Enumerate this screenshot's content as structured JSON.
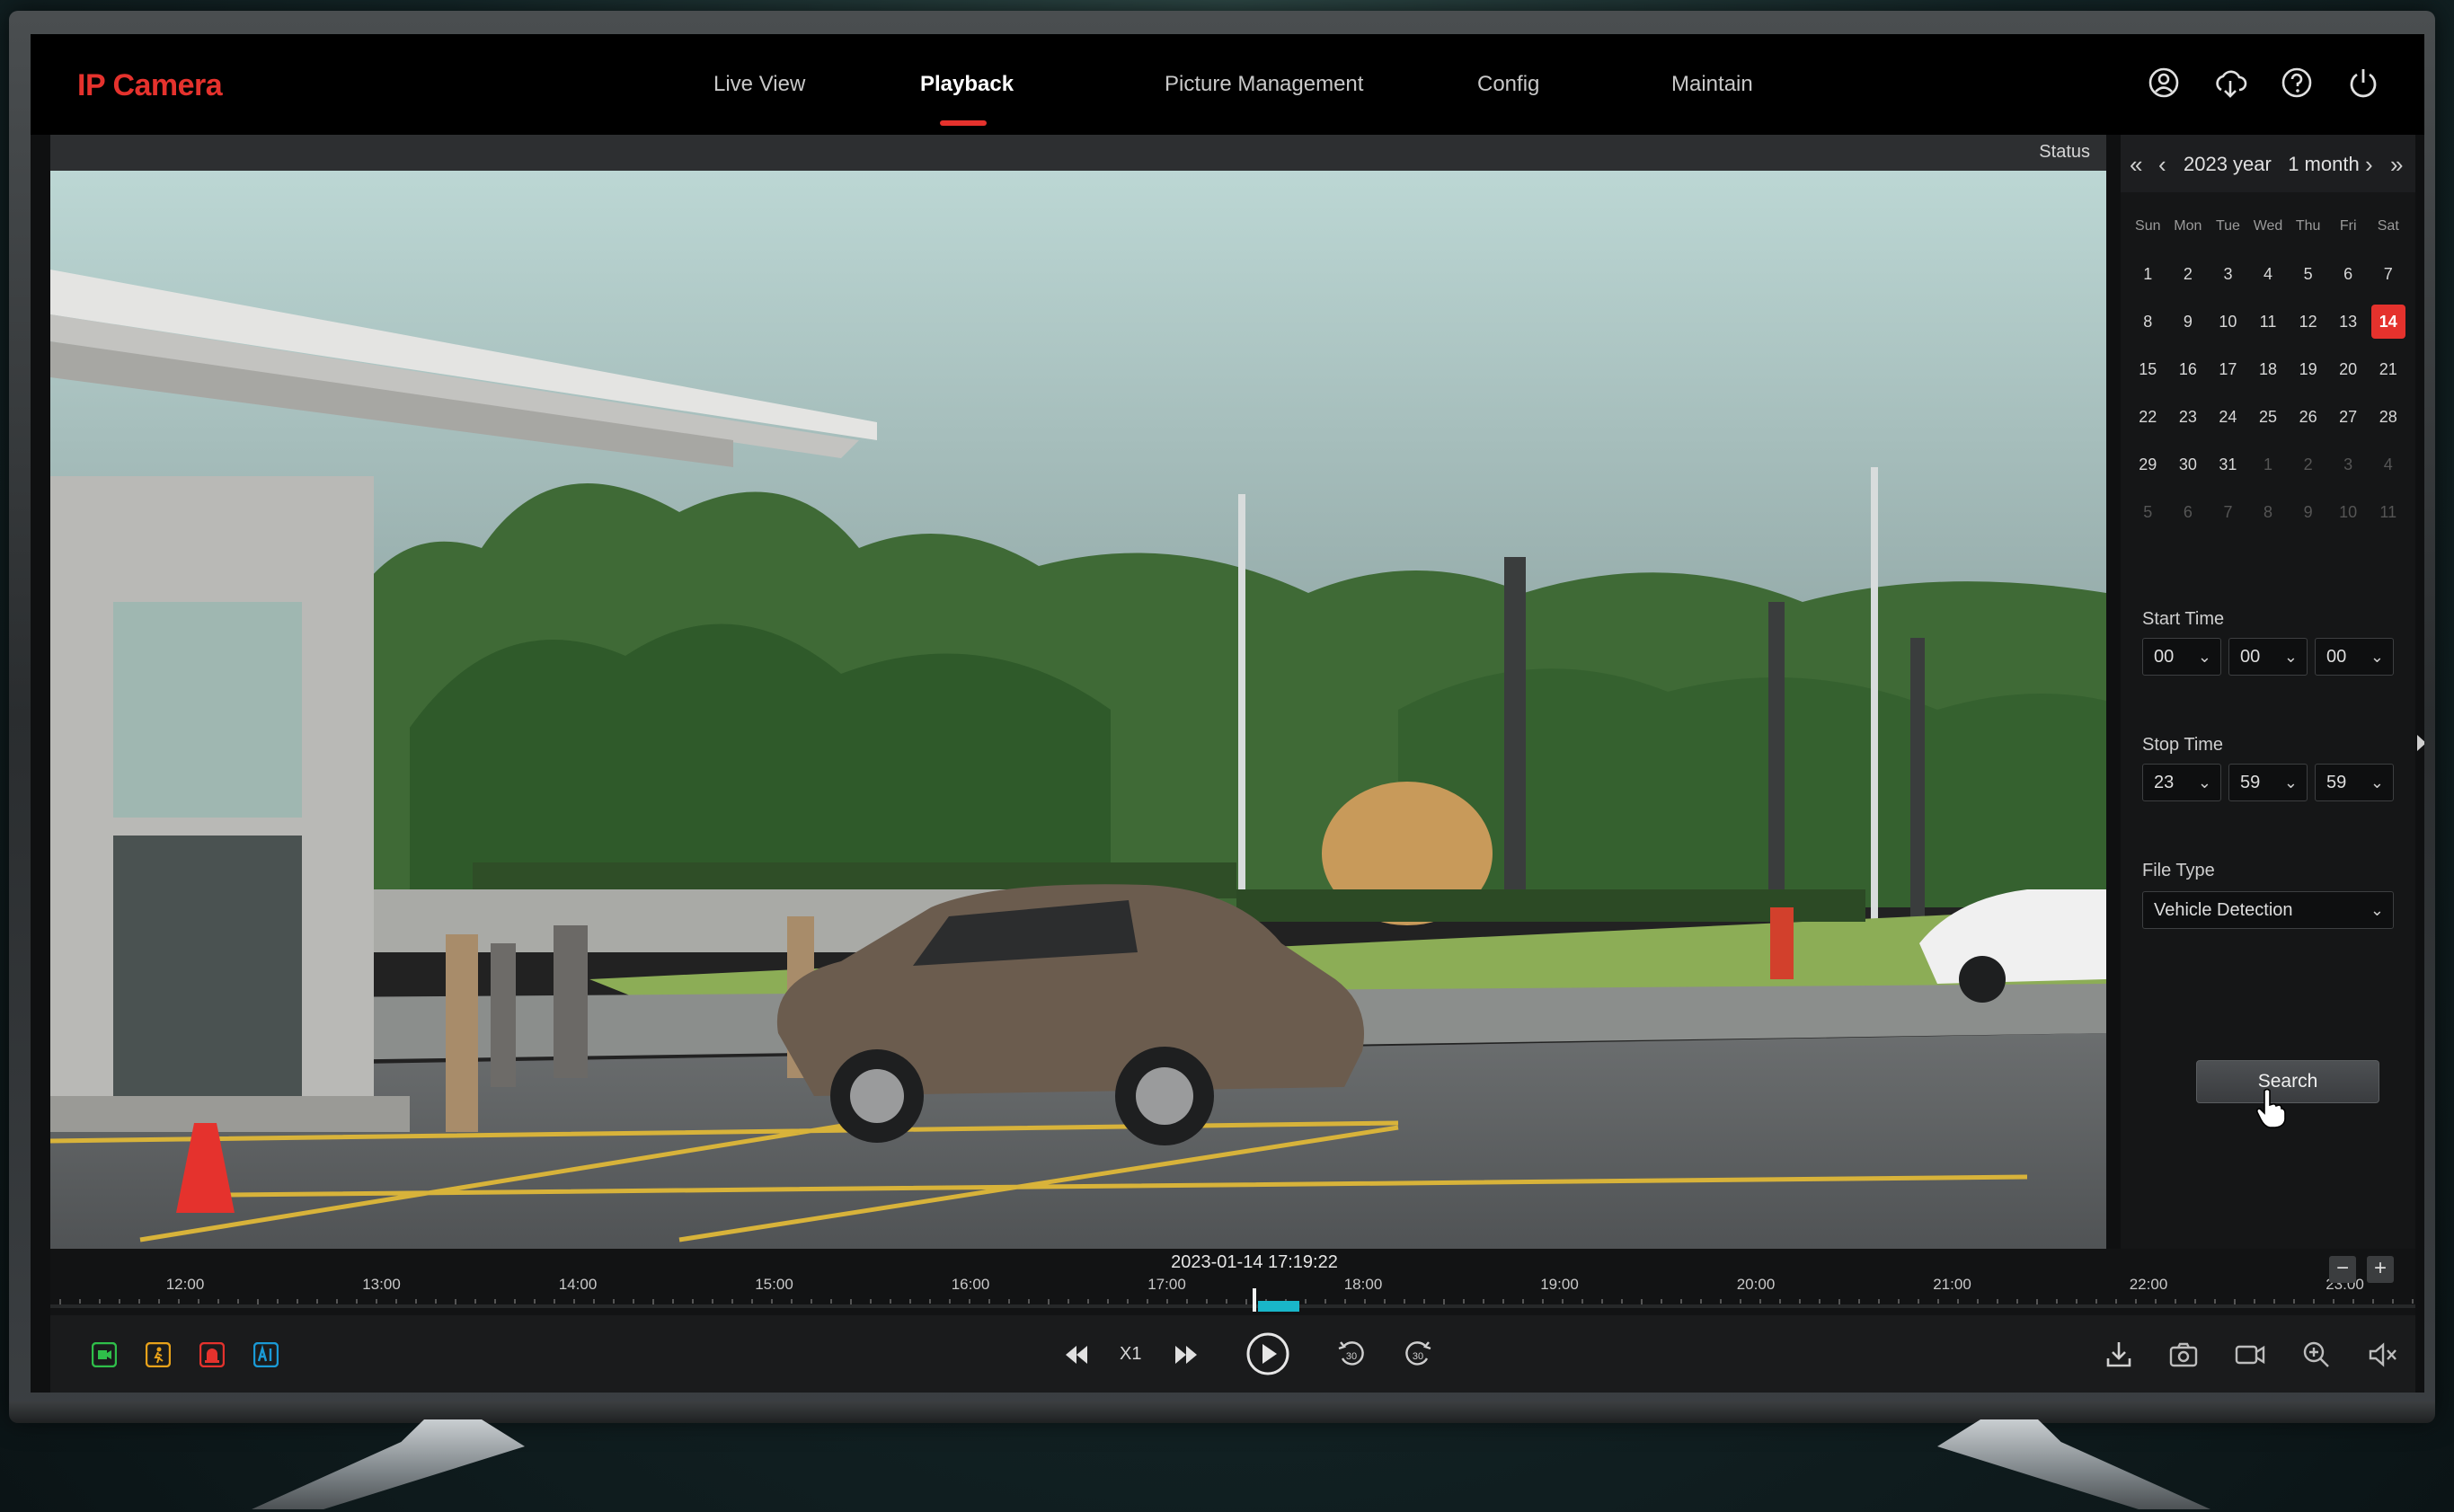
{
  "brand": "IP Camera",
  "nav": {
    "live_view": "Live View",
    "playback": "Playback",
    "picture_management": "Picture Management",
    "config": "Config",
    "maintain": "Maintain"
  },
  "top_icons": [
    "user-icon",
    "cloud-download-icon",
    "help-icon",
    "power-icon"
  ],
  "video": {
    "status_label": "Status"
  },
  "calendar": {
    "prev_year": "«",
    "prev_month": "‹",
    "next_month": "›",
    "next_year": "»",
    "title": "2023 year   1 month",
    "weekdays": [
      "Sun",
      "Mon",
      "Tue",
      "Wed",
      "Thu",
      "Fri",
      "Sat"
    ],
    "weeks": [
      [
        "1",
        "2",
        "3",
        "4",
        "5",
        "6",
        "7"
      ],
      [
        "8",
        "9",
        "10",
        "11",
        "12",
        "13",
        "14"
      ],
      [
        "15",
        "16",
        "17",
        "18",
        "19",
        "20",
        "21"
      ],
      [
        "22",
        "23",
        "24",
        "25",
        "26",
        "27",
        "28"
      ],
      [
        "29",
        "30",
        "31",
        "1",
        "2",
        "3",
        "4"
      ],
      [
        "5",
        "6",
        "7",
        "8",
        "9",
        "10",
        "11"
      ]
    ],
    "selected_day": "14"
  },
  "start_time": {
    "label": "Start Time",
    "hour": "00",
    "minute": "00",
    "second": "00"
  },
  "stop_time": {
    "label": "Stop Time",
    "hour": "23",
    "minute": "59",
    "second": "59"
  },
  "file_type": {
    "label": "File Type",
    "value": "Vehicle Detection"
  },
  "search_label": "Search",
  "timeline": {
    "current": "2023-01-14 17:19:22",
    "hours": [
      "12:00",
      "13:00",
      "14:00",
      "15:00",
      "16:00",
      "17:00",
      "18:00",
      "19:00",
      "20:00",
      "21:00",
      "22:00",
      "23:00"
    ],
    "zoom_out": "−",
    "zoom_in": "+"
  },
  "controls": {
    "speed": "X1",
    "filter_colors": {
      "normal": "#2fbf4a",
      "motion": "#e8a21a",
      "alarm": "#e5322d",
      "ai": "#1a9ad6"
    }
  },
  "colors": {
    "accent": "#e5322d",
    "record_bar": "#19b6c9"
  }
}
